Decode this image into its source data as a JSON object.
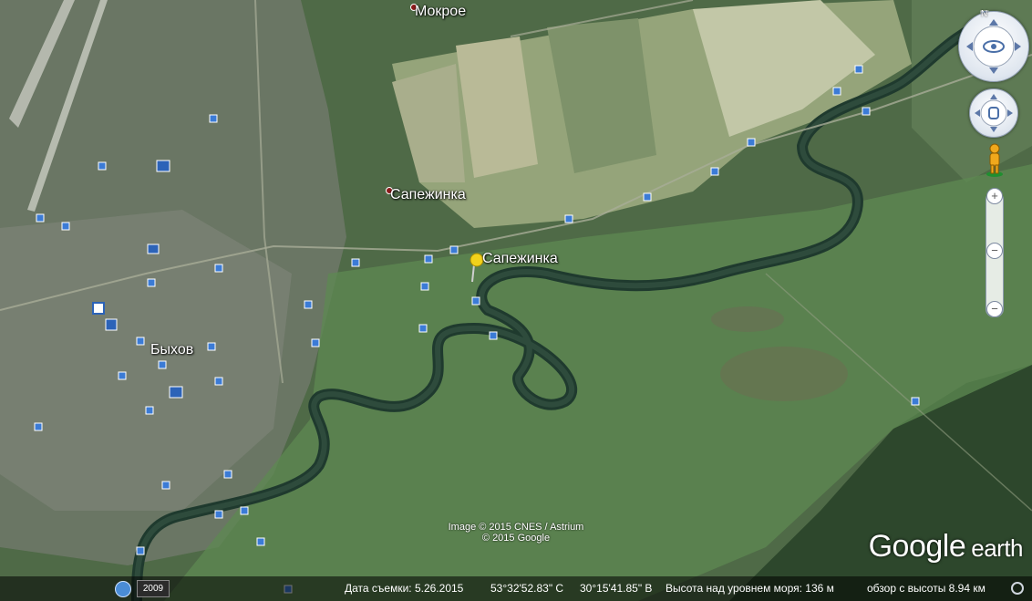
{
  "places": [
    {
      "name": "Мокрое"
    },
    {
      "name": "Сапежинка"
    },
    {
      "name": "Сапежинка"
    },
    {
      "name": "Быхов"
    }
  ],
  "credits": {
    "line1": "Image © 2015 CNES / Astrium",
    "line2": "© 2015 Google"
  },
  "logo": {
    "google": "Google",
    "earth": "earth"
  },
  "status": {
    "history_year": "2009",
    "date": "Дата съемки: 5.26.2015",
    "lat": "53°32'52.83\" С",
    "lon": "30°15'41.85\" В",
    "elevation": "Высота над уровнем моря:   136 м",
    "eye_alt": "обзор с высоты   8.94 км"
  },
  "colors": {
    "river": "#1f3a2e",
    "fields": "#9aa87f",
    "forest": "#2f4a2f",
    "town": "#6f7a6a",
    "pin": "#f2d21b"
  }
}
